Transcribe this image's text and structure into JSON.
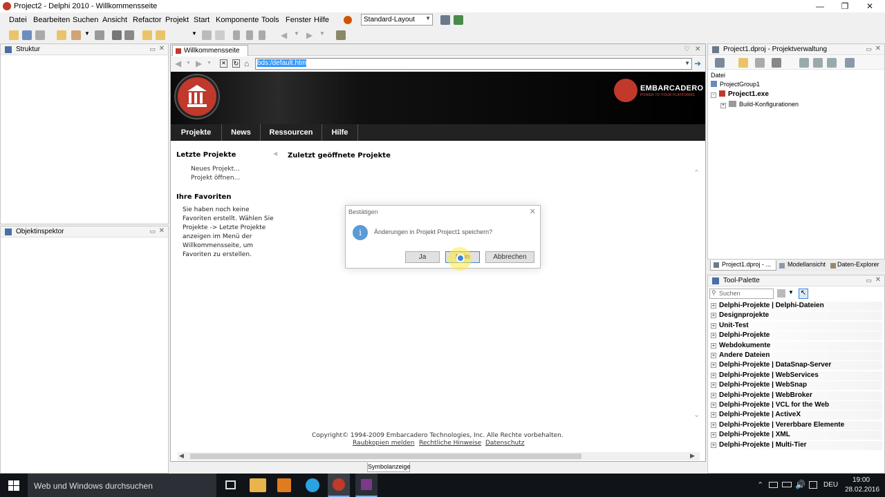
{
  "window": {
    "title": "Project2 - Delphi 2010 - Willkommensseite"
  },
  "menu": [
    "Datei",
    "Bearbeiten",
    "Suchen",
    "Ansicht",
    "Refactor",
    "Projekt",
    "Start",
    "Komponente",
    "Tools",
    "Fenster",
    "Hilfe"
  ],
  "toolbar": {
    "layout_combo": "Standard-Layout"
  },
  "left": {
    "structure_title": "Struktur",
    "inspector_title": "Objektinspektor"
  },
  "browser": {
    "tab_label": "Willkommensseite",
    "url": "bds:/default.htm",
    "brand": "EMBARCADERO",
    "brand_tagline": "POWER TO YOUR PLATFORMS",
    "nav": [
      "Projekte",
      "News",
      "Ressourcen",
      "Hilfe"
    ],
    "recent_heading": "Letzte Projekte",
    "new_project": "Neues Projekt...",
    "open_project": "Projekt öffnen...",
    "favorites_heading": "Ihre Favoriten",
    "favorites_text": "Sie haben noch keine Favoriten erstellt. Wählen Sie Projekte -> Letzte Projekte anzeigen im Menü der Willkommensseite, um Favoriten zu erstellen.",
    "recent_opened_heading": "Zuletzt geöffnete Projekte",
    "copyright": "Copyright© 1994-2009 Embarcadero Technologies, Inc. Alle Rechte vorbehalten.",
    "links": [
      "Raubkopien melden",
      "Rechtliche Hinweise",
      "Datenschutz"
    ],
    "bottom_tab": "Symbolanzeige"
  },
  "dialog": {
    "title": "Bestätigen",
    "message": "Änderungen in Projekt Project1 speichern?",
    "buttons": [
      "Ja",
      "Nein",
      "Abbrechen"
    ]
  },
  "project_manager": {
    "title": "Project1.dproj - Projektverwaltung",
    "header": "Datei",
    "tree": [
      "ProjectGroup1",
      "Project1.exe",
      "Build-Konfigurationen"
    ],
    "tabs": [
      "Project1.dproj - ...",
      "Modellansicht",
      "Daten-Explorer"
    ]
  },
  "tool_palette": {
    "title": "Tool-Palette",
    "search_placeholder": "Suchen",
    "categories": [
      "Delphi-Projekte | Delphi-Dateien",
      "Designprojekte",
      "Unit-Test",
      "Delphi-Projekte",
      "Webdokumente",
      "Andere Dateien",
      "Delphi-Projekte | DataSnap-Server",
      "Delphi-Projekte | WebServices",
      "Delphi-Projekte | WebSnap",
      "Delphi-Projekte | WebBroker",
      "Delphi-Projekte | VCL for the Web",
      "Delphi-Projekte | ActiveX",
      "Delphi-Projekte | Vererbbare Elemente",
      "Delphi-Projekte | XML",
      "Delphi-Projekte | Multi-Tier"
    ]
  },
  "taskbar": {
    "search_text": "Web und Windows durchsuchen",
    "lang": "DEU",
    "time": "19:00",
    "date": "28.02.2016"
  }
}
